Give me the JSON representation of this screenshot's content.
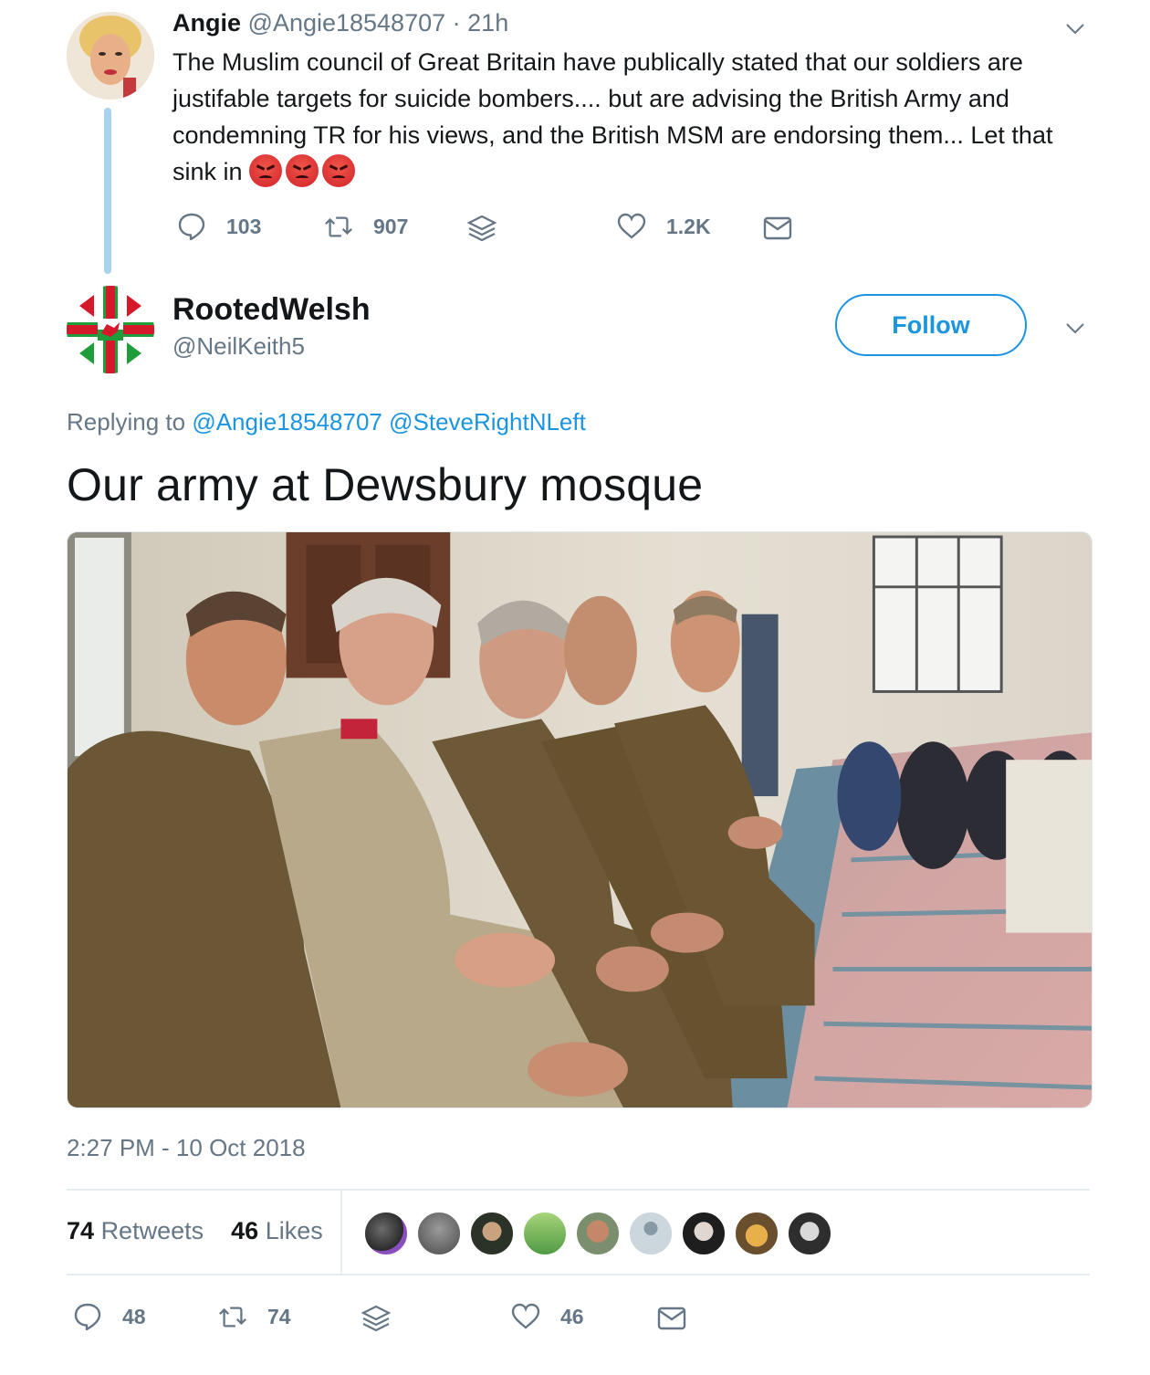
{
  "parent_tweet": {
    "name": "Angie",
    "handle": "@Angie18548707",
    "separator": "·",
    "time": "21h",
    "text": "The Muslim council of Great Britain have publically stated that our soldiers are justifable targets for suicide bombers.... but are advising the British Army  and condemning TR for his views,  and the British MSM are endorsing them... Let that sink in",
    "emoji": [
      "angry-face",
      "angry-face",
      "angry-face"
    ],
    "replies": "103",
    "retweets": "907",
    "likes": "1.2K"
  },
  "main_tweet": {
    "name": "RootedWelsh",
    "handle": "@NeilKeith5",
    "follow_label": "Follow",
    "replying_prefix": "Replying to",
    "replying_to": [
      "@Angie18548707",
      "@SteveRightNLeft"
    ],
    "text": "Our army at Dewsbury mosque",
    "timestamp": "2:27 PM - 10 Oct 2018",
    "retweet_count": "74",
    "retweet_label": "Retweets",
    "like_count": "46",
    "like_label": "Likes",
    "actions": {
      "replies": "48",
      "retweets": "74",
      "likes": "46"
    }
  },
  "colors": {
    "accent": "#1b95e0",
    "muted": "#657786",
    "thread_line": "#a9d3ec",
    "liker_avatars": [
      "#4a4a4a",
      "#6e6e6e",
      "#3d4a3a",
      "#7fb069",
      "#b5735b",
      "#ccd6dd",
      "#2c2c2c",
      "#8a6a3b",
      "#3a3a3a"
    ]
  }
}
